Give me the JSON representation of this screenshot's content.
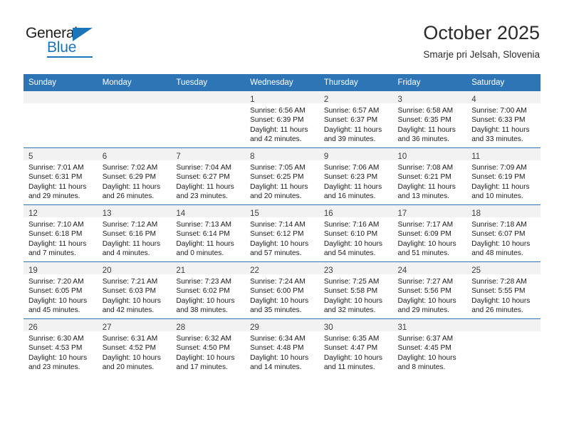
{
  "brand": {
    "name_part1": "General",
    "name_part2": "Blue"
  },
  "header": {
    "title": "October 2025",
    "subtitle": "Smarje pri Jelsah, Slovenia"
  },
  "calendar": {
    "weekday_headers": [
      "Sunday",
      "Monday",
      "Tuesday",
      "Wednesday",
      "Thursday",
      "Friday",
      "Saturday"
    ],
    "accent_color": "#2e75b6",
    "daynum_band_color": "#f2f2f2",
    "weeks": [
      [
        {
          "empty": true
        },
        {
          "empty": true
        },
        {
          "empty": true
        },
        {
          "day": "1",
          "sunrise": "Sunrise: 6:56 AM",
          "sunset": "Sunset: 6:39 PM",
          "daylight1": "Daylight: 11 hours",
          "daylight2": "and 42 minutes."
        },
        {
          "day": "2",
          "sunrise": "Sunrise: 6:57 AM",
          "sunset": "Sunset: 6:37 PM",
          "daylight1": "Daylight: 11 hours",
          "daylight2": "and 39 minutes."
        },
        {
          "day": "3",
          "sunrise": "Sunrise: 6:58 AM",
          "sunset": "Sunset: 6:35 PM",
          "daylight1": "Daylight: 11 hours",
          "daylight2": "and 36 minutes."
        },
        {
          "day": "4",
          "sunrise": "Sunrise: 7:00 AM",
          "sunset": "Sunset: 6:33 PM",
          "daylight1": "Daylight: 11 hours",
          "daylight2": "and 33 minutes."
        }
      ],
      [
        {
          "day": "5",
          "sunrise": "Sunrise: 7:01 AM",
          "sunset": "Sunset: 6:31 PM",
          "daylight1": "Daylight: 11 hours",
          "daylight2": "and 29 minutes."
        },
        {
          "day": "6",
          "sunrise": "Sunrise: 7:02 AM",
          "sunset": "Sunset: 6:29 PM",
          "daylight1": "Daylight: 11 hours",
          "daylight2": "and 26 minutes."
        },
        {
          "day": "7",
          "sunrise": "Sunrise: 7:04 AM",
          "sunset": "Sunset: 6:27 PM",
          "daylight1": "Daylight: 11 hours",
          "daylight2": "and 23 minutes."
        },
        {
          "day": "8",
          "sunrise": "Sunrise: 7:05 AM",
          "sunset": "Sunset: 6:25 PM",
          "daylight1": "Daylight: 11 hours",
          "daylight2": "and 20 minutes."
        },
        {
          "day": "9",
          "sunrise": "Sunrise: 7:06 AM",
          "sunset": "Sunset: 6:23 PM",
          "daylight1": "Daylight: 11 hours",
          "daylight2": "and 16 minutes."
        },
        {
          "day": "10",
          "sunrise": "Sunrise: 7:08 AM",
          "sunset": "Sunset: 6:21 PM",
          "daylight1": "Daylight: 11 hours",
          "daylight2": "and 13 minutes."
        },
        {
          "day": "11",
          "sunrise": "Sunrise: 7:09 AM",
          "sunset": "Sunset: 6:19 PM",
          "daylight1": "Daylight: 11 hours",
          "daylight2": "and 10 minutes."
        }
      ],
      [
        {
          "day": "12",
          "sunrise": "Sunrise: 7:10 AM",
          "sunset": "Sunset: 6:18 PM",
          "daylight1": "Daylight: 11 hours",
          "daylight2": "and 7 minutes."
        },
        {
          "day": "13",
          "sunrise": "Sunrise: 7:12 AM",
          "sunset": "Sunset: 6:16 PM",
          "daylight1": "Daylight: 11 hours",
          "daylight2": "and 4 minutes."
        },
        {
          "day": "14",
          "sunrise": "Sunrise: 7:13 AM",
          "sunset": "Sunset: 6:14 PM",
          "daylight1": "Daylight: 11 hours",
          "daylight2": "and 0 minutes."
        },
        {
          "day": "15",
          "sunrise": "Sunrise: 7:14 AM",
          "sunset": "Sunset: 6:12 PM",
          "daylight1": "Daylight: 10 hours",
          "daylight2": "and 57 minutes."
        },
        {
          "day": "16",
          "sunrise": "Sunrise: 7:16 AM",
          "sunset": "Sunset: 6:10 PM",
          "daylight1": "Daylight: 10 hours",
          "daylight2": "and 54 minutes."
        },
        {
          "day": "17",
          "sunrise": "Sunrise: 7:17 AM",
          "sunset": "Sunset: 6:09 PM",
          "daylight1": "Daylight: 10 hours",
          "daylight2": "and 51 minutes."
        },
        {
          "day": "18",
          "sunrise": "Sunrise: 7:18 AM",
          "sunset": "Sunset: 6:07 PM",
          "daylight1": "Daylight: 10 hours",
          "daylight2": "and 48 minutes."
        }
      ],
      [
        {
          "day": "19",
          "sunrise": "Sunrise: 7:20 AM",
          "sunset": "Sunset: 6:05 PM",
          "daylight1": "Daylight: 10 hours",
          "daylight2": "and 45 minutes."
        },
        {
          "day": "20",
          "sunrise": "Sunrise: 7:21 AM",
          "sunset": "Sunset: 6:03 PM",
          "daylight1": "Daylight: 10 hours",
          "daylight2": "and 42 minutes."
        },
        {
          "day": "21",
          "sunrise": "Sunrise: 7:23 AM",
          "sunset": "Sunset: 6:02 PM",
          "daylight1": "Daylight: 10 hours",
          "daylight2": "and 38 minutes."
        },
        {
          "day": "22",
          "sunrise": "Sunrise: 7:24 AM",
          "sunset": "Sunset: 6:00 PM",
          "daylight1": "Daylight: 10 hours",
          "daylight2": "and 35 minutes."
        },
        {
          "day": "23",
          "sunrise": "Sunrise: 7:25 AM",
          "sunset": "Sunset: 5:58 PM",
          "daylight1": "Daylight: 10 hours",
          "daylight2": "and 32 minutes."
        },
        {
          "day": "24",
          "sunrise": "Sunrise: 7:27 AM",
          "sunset": "Sunset: 5:56 PM",
          "daylight1": "Daylight: 10 hours",
          "daylight2": "and 29 minutes."
        },
        {
          "day": "25",
          "sunrise": "Sunrise: 7:28 AM",
          "sunset": "Sunset: 5:55 PM",
          "daylight1": "Daylight: 10 hours",
          "daylight2": "and 26 minutes."
        }
      ],
      [
        {
          "day": "26",
          "sunrise": "Sunrise: 6:30 AM",
          "sunset": "Sunset: 4:53 PM",
          "daylight1": "Daylight: 10 hours",
          "daylight2": "and 23 minutes."
        },
        {
          "day": "27",
          "sunrise": "Sunrise: 6:31 AM",
          "sunset": "Sunset: 4:52 PM",
          "daylight1": "Daylight: 10 hours",
          "daylight2": "and 20 minutes."
        },
        {
          "day": "28",
          "sunrise": "Sunrise: 6:32 AM",
          "sunset": "Sunset: 4:50 PM",
          "daylight1": "Daylight: 10 hours",
          "daylight2": "and 17 minutes."
        },
        {
          "day": "29",
          "sunrise": "Sunrise: 6:34 AM",
          "sunset": "Sunset: 4:48 PM",
          "daylight1": "Daylight: 10 hours",
          "daylight2": "and 14 minutes."
        },
        {
          "day": "30",
          "sunrise": "Sunrise: 6:35 AM",
          "sunset": "Sunset: 4:47 PM",
          "daylight1": "Daylight: 10 hours",
          "daylight2": "and 11 minutes."
        },
        {
          "day": "31",
          "sunrise": "Sunrise: 6:37 AM",
          "sunset": "Sunset: 4:45 PM",
          "daylight1": "Daylight: 10 hours",
          "daylight2": "and 8 minutes."
        },
        {
          "empty": true
        }
      ]
    ]
  }
}
